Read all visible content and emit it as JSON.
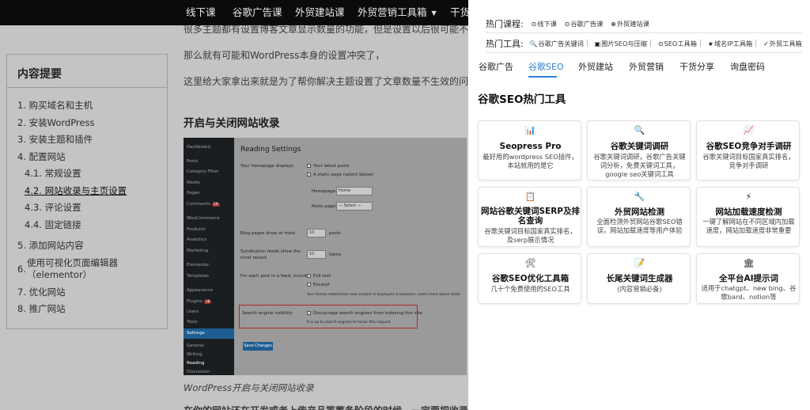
{
  "topnav": {
    "items": [
      "线下课",
      "谷歌广告课",
      "外贸建站课",
      "外贸营销工具箱",
      "干货"
    ],
    "dropdown_caret": "▼"
  },
  "article": {
    "para1": "很多主题都有设置博客文章显示数量的功能，但是设置以后很可能不生效，",
    "para2": "那么就有可能和WordPress本身的设置冲突了，",
    "para3": "这里给大家拿出来就是为了帮你解决主题设置了文章数量不生效的问题。",
    "heading": "开启与关闭网站收录",
    "caption": "WordPress开启与关闭网站收录",
    "bottom_cut": "在你的网站还在开发或者上传产品等筹备阶段的时候，一定要把收录关闭"
  },
  "toc": {
    "title": "内容提要",
    "items": [
      {
        "num": "1.",
        "label": "购买域名和主机"
      },
      {
        "num": "2.",
        "label": "安装WordPress"
      },
      {
        "num": "3.",
        "label": "安装主题和插件"
      },
      {
        "num": "4.",
        "label": "配置网站"
      },
      {
        "num": "4.1.",
        "label": "常规设置"
      },
      {
        "num": "4.2.",
        "label": "网站收录与主页设置"
      },
      {
        "num": "4.3.",
        "label": "评论设置"
      },
      {
        "num": "4.4.",
        "label": "固定链接"
      },
      {
        "num": "5.",
        "label": "添加网站内容"
      },
      {
        "num": "6.",
        "label": "使用可视化页面编辑器"
      },
      {
        "num": "",
        "label": "（elementor）"
      },
      {
        "num": "7.",
        "label": "优化网站"
      },
      {
        "num": "8.",
        "label": "推广网站"
      }
    ]
  },
  "wp_screenshot": {
    "sidebar": [
      "Dashboard",
      "Posts",
      "Category Filter",
      "Media",
      "Pages",
      "Comments",
      "WooCommerce",
      "Products",
      "Analytics",
      "Marketing",
      "Elementor",
      "Templates",
      "Appearance",
      "Plugins",
      "Users",
      "Tools",
      "Settings",
      "General",
      "Writing",
      "Reading",
      "Discussion"
    ],
    "comments_badge": "29",
    "plugins_badge": "18",
    "page_title": "Reading Settings",
    "homepage_displays": "Your homepage displays",
    "latest_posts": "Your latest posts",
    "static_page": "A static page (select below)",
    "homepage_label": "Homepage:",
    "homepage_value": "Home",
    "posts_page_label": "Posts page:",
    "posts_page_value": "— Select —",
    "blog_pages": "Blog pages show at most",
    "blog_pages_value": "10",
    "posts_unit": "posts",
    "syndication": "Syndication feeds show the most recent",
    "syndication_value": "10",
    "items_unit": "items",
    "feed_include": "For each post in a feed, include",
    "full_text": "Full text",
    "excerpt": "Excerpt",
    "feed_note": "Your theme determines how content is displayed in browsers. Learn more about feeds",
    "search_visibility": "Search engine visibility",
    "discourage": "Discourage search engines from indexing this site",
    "discourage_note": "It is up to search engines to honor this request.",
    "save_button": "Save Changes"
  },
  "panel": {
    "hot_courses_label": "热门课程:",
    "hot_courses": [
      {
        "icon": "⊙",
        "label": "线下课"
      },
      {
        "icon": "⊙",
        "label": "谷歌广告课"
      },
      {
        "icon": "⊕",
        "label": "外贸建站课"
      }
    ],
    "hot_tools_label": "热门工具:",
    "hot_tools": [
      {
        "icon": "🔍",
        "label": "谷歌广告关键词"
      },
      {
        "icon": "▣",
        "label": "图片SEO与压缩"
      },
      {
        "icon": "⊙",
        "label": "SEO工具箱"
      },
      {
        "icon": "★",
        "label": "域名IP工具箱"
      },
      {
        "icon": "✓",
        "label": "外贸工具箱"
      }
    ],
    "tabs": [
      "谷歌广告",
      "谷歌SEO",
      "外贸建站",
      "外贸营销",
      "干货分享",
      "询盘密码"
    ],
    "active_tab": "谷歌SEO",
    "section_title": "谷歌SEO热门工具",
    "cards": [
      {
        "icon": "📊",
        "title": "Seopress Pro",
        "desc": "最好用的wordpress SEO插件，本站就用的是它"
      },
      {
        "icon": "🔍",
        "title": "谷歌关键词调研",
        "desc": "谷歌关键词调研，谷歌广告关键词分析，免费关键词工具，google seo关键词工具"
      },
      {
        "icon": "📈",
        "title": "谷歌SEO竞争对手调研",
        "desc": "谷歌关键词目标国家真实排名，竞争对手调研"
      },
      {
        "icon": "📋",
        "title": "网站谷歌关键词SERP及排名查询",
        "desc": "谷歌关键词目标国家真实排名，及serp展示情况"
      },
      {
        "icon": "🔧",
        "title": "外贸网站检测",
        "desc": "全面检测外贸网站谷歌SEO错误，网站加载速度等用户体验"
      },
      {
        "icon": "⚡",
        "title": "网站加载速度检测",
        "desc": "一键了解网站在不同区域内加载速度，网站加载速度非常重要"
      },
      {
        "icon": "🛠",
        "title": "谷歌SEO优化工具箱",
        "desc": "几十个免费使用的SEO工具"
      },
      {
        "icon": "📝",
        "title": "长尾关键词生成器",
        "desc": "(内容营销必备)"
      },
      {
        "icon": "🏛",
        "title": "全平台AI提示词",
        "desc": "适用于chatgpt、new bing、谷歌bard、notion等"
      }
    ]
  },
  "colors": {
    "accent": "#2f7fd1",
    "topnav_bg": "#0b0b0b",
    "overlay_bg": "#c4c4c4",
    "highlight_red": "#b3262b"
  }
}
